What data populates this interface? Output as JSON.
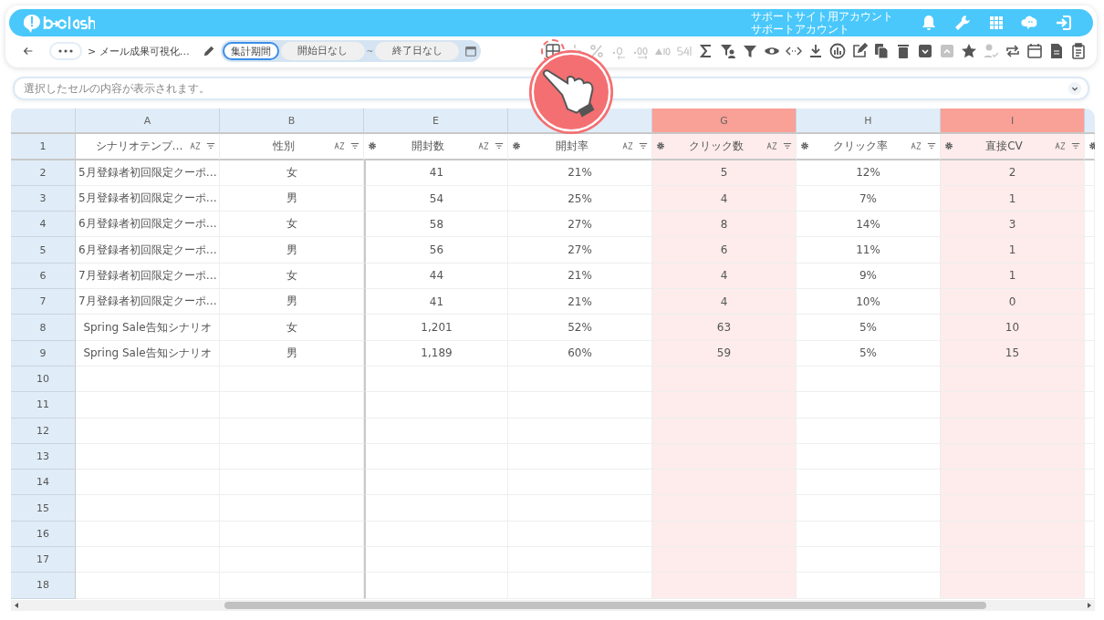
{
  "app": {
    "account_lines": [
      "サポートサイト用アカウント",
      "サポートアカウント"
    ]
  },
  "toolbar": {
    "breadcrumb": "> メール成果可視化…",
    "period_tabs": [
      {
        "label": "集計期間",
        "selected": true
      }
    ],
    "start_date": "開始日なし",
    "range_sep": "~",
    "end_date": "終了日なし",
    "tools": [
      {
        "kind": "grid",
        "disabled": false,
        "highlighted": true
      },
      {
        "kind": "sparkle",
        "disabled": true,
        "highlighted": false
      },
      {
        "kind": "percent",
        "disabled": true,
        "highlighted": false
      },
      {
        "kind": "decimal-decrease",
        "disabled": true,
        "highlighted": false
      },
      {
        "kind": "decimal-increase",
        "disabled": true,
        "highlighted": false
      },
      {
        "kind": "triangle-up",
        "disabled": true,
        "highlighted": false
      },
      {
        "kind": "swap-digits",
        "disabled": true,
        "highlighted": false
      },
      {
        "kind": "sigma",
        "disabled": false,
        "highlighted": false
      },
      {
        "kind": "filter-user",
        "disabled": false,
        "highlighted": false
      },
      {
        "kind": "filter",
        "disabled": false,
        "highlighted": false
      },
      {
        "kind": "eye",
        "disabled": false,
        "highlighted": false
      },
      {
        "kind": "code",
        "disabled": false,
        "highlighted": false
      },
      {
        "kind": "download",
        "disabled": false,
        "highlighted": false
      },
      {
        "kind": "chart-circle",
        "disabled": false,
        "highlighted": false
      },
      {
        "kind": "edit",
        "disabled": false,
        "highlighted": false
      },
      {
        "kind": "copy",
        "disabled": false,
        "highlighted": false
      },
      {
        "kind": "trash",
        "disabled": false,
        "highlighted": false
      },
      {
        "kind": "box-down",
        "disabled": false,
        "highlighted": false
      },
      {
        "kind": "box-up",
        "disabled": true,
        "highlighted": false
      },
      {
        "kind": "star",
        "disabled": false,
        "highlighted": false
      },
      {
        "kind": "user-check",
        "disabled": true,
        "highlighted": false
      },
      {
        "kind": "repeat",
        "disabled": false,
        "highlighted": false
      },
      {
        "kind": "calendar",
        "disabled": false,
        "highlighted": false
      },
      {
        "kind": "file",
        "disabled": false,
        "highlighted": false
      },
      {
        "kind": "clipboard",
        "disabled": false,
        "highlighted": false
      }
    ]
  },
  "formula_bar": {
    "placeholder": "選択したセルの内容が表示されます。"
  },
  "sheet": {
    "columns": [
      {
        "letter": "A",
        "title": "シナリオテンプ…",
        "gear": false,
        "selected": false
      },
      {
        "letter": "B",
        "title": "性別",
        "gear": false,
        "selected": false
      },
      {
        "letter": "E",
        "title": "開封数",
        "gear": true,
        "selected": false
      },
      {
        "title": "開封率",
        "gear": true,
        "selected": false
      },
      {
        "letter": "G",
        "title": "クリック数",
        "gear": true,
        "selected": true
      },
      {
        "letter": "H",
        "title": "クリック率",
        "gear": true,
        "selected": false
      },
      {
        "letter": "I",
        "title": "直接CV",
        "gear": true,
        "selected": true
      }
    ],
    "row_numbers": [
      "1",
      "2",
      "3",
      "4",
      "5",
      "6",
      "7",
      "8",
      "9",
      "10",
      "11",
      "12",
      "13",
      "14",
      "15",
      "16",
      "17",
      "18"
    ],
    "rows": [
      [
        "5月登録者初回限定クーポ…",
        "女",
        "41",
        "21%",
        "5",
        "12%",
        "2"
      ],
      [
        "5月登録者初回限定クーポ…",
        "男",
        "54",
        "25%",
        "4",
        "7%",
        "1"
      ],
      [
        "6月登録者初回限定クーポ…",
        "女",
        "58",
        "27%",
        "8",
        "14%",
        "3"
      ],
      [
        "6月登録者初回限定クーポ…",
        "男",
        "56",
        "27%",
        "6",
        "11%",
        "1"
      ],
      [
        "7月登録者初回限定クーポ…",
        "女",
        "44",
        "21%",
        "4",
        "9%",
        "1"
      ],
      [
        "7月登録者初回限定クーポ…",
        "男",
        "41",
        "21%",
        "4",
        "10%",
        "0"
      ],
      [
        "Spring Sale告知シナリオ",
        "女",
        "1,201",
        "52%",
        "63",
        "5%",
        "10"
      ],
      [
        "Spring Sale告知シナリオ",
        "男",
        "1,189",
        "60%",
        "59",
        "5%",
        "15"
      ]
    ]
  }
}
